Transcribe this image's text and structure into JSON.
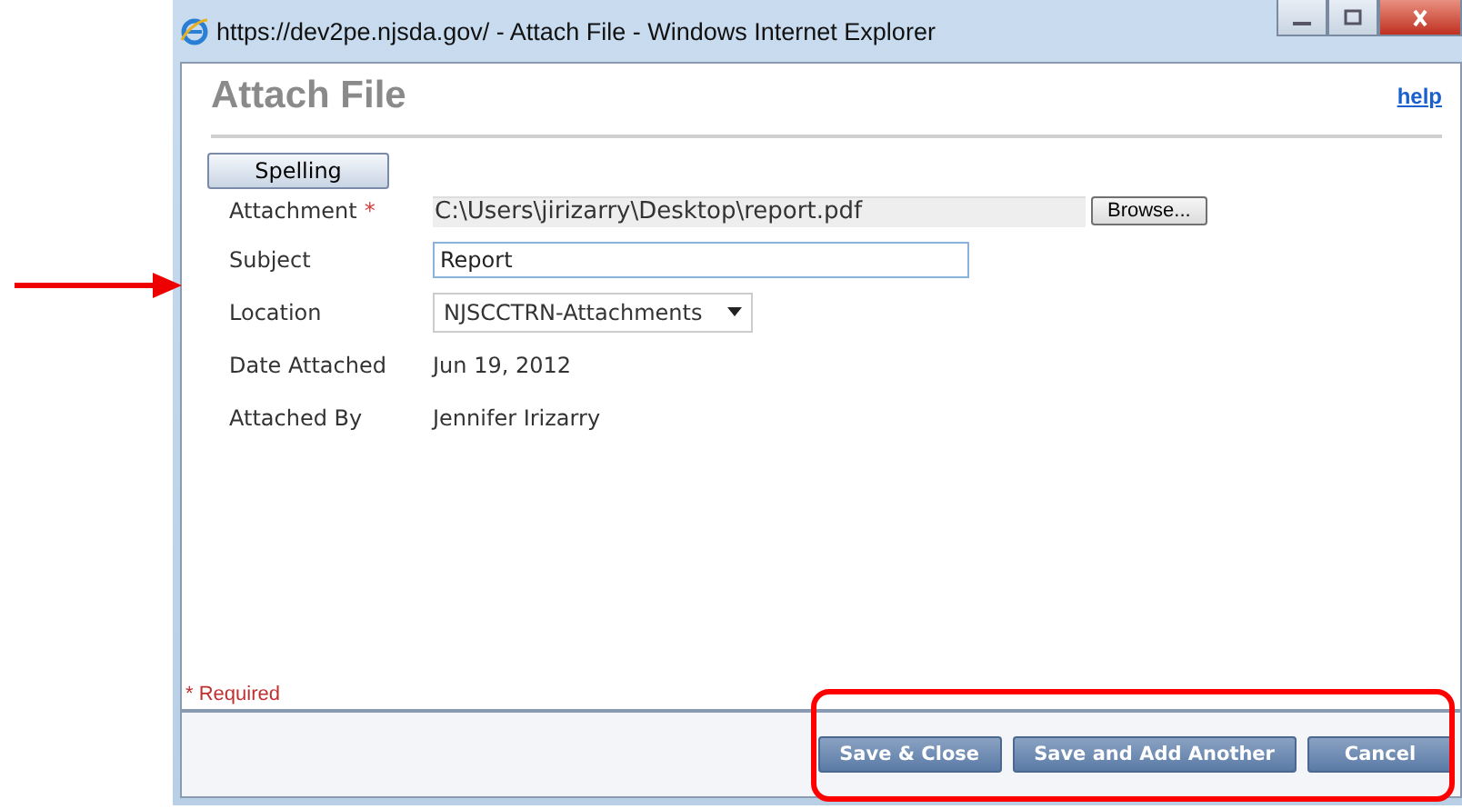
{
  "window": {
    "title": "https://dev2pe.njsda.gov/ - Attach File - Windows Internet Explorer"
  },
  "header": {
    "title": "Attach File",
    "help": "help"
  },
  "spelling_button": "Spelling",
  "fields": [
    {
      "kind": "file",
      "label": "Attachment",
      "required_mark": "*",
      "value": "C:\\Users\\jirizarry\\Desktop\\report.pdf",
      "button": "Browse..."
    },
    {
      "kind": "input",
      "label": "Subject",
      "value": "Report"
    },
    {
      "kind": "select",
      "label": "Location",
      "value": "NJSCCTRN-Attachments"
    },
    {
      "kind": "text",
      "label": "Date Attached",
      "value": "Jun 19, 2012"
    },
    {
      "kind": "text",
      "label": "Attached By",
      "value": "Jennifer Irizarry"
    }
  ],
  "required_note": "* Required",
  "buttons": [
    "Save & Close",
    "Save and Add Another",
    "Cancel"
  ]
}
